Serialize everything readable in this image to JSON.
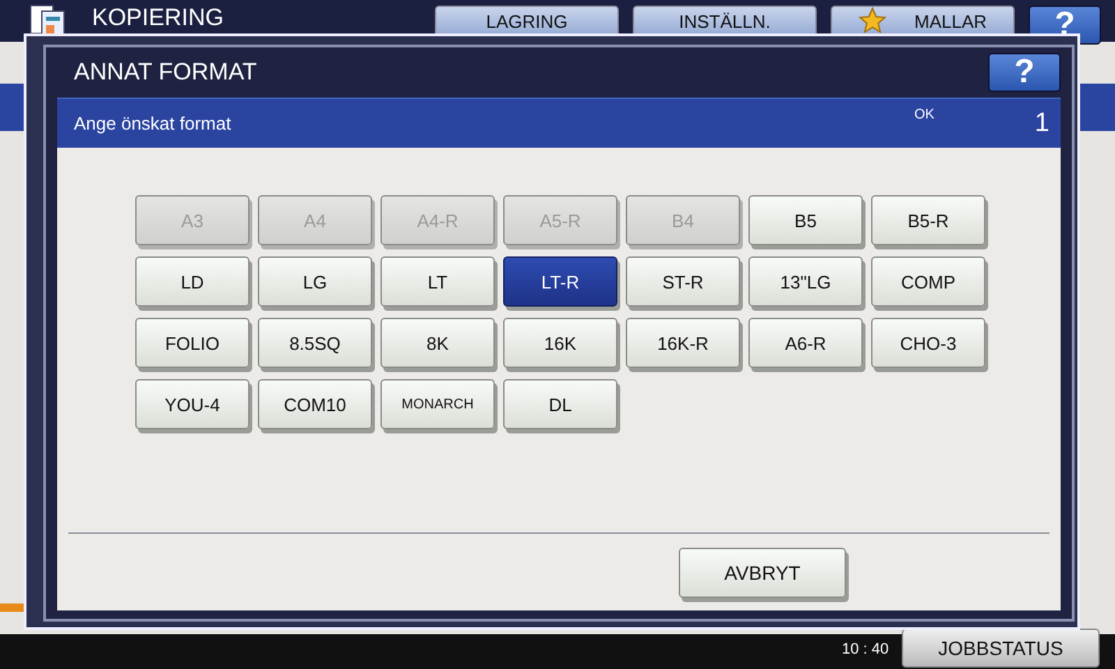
{
  "screen": {
    "title": "KOPIERING",
    "tabs": [
      {
        "label": "LAGRING",
        "icon": false
      },
      {
        "label": "INSTÄLLN.",
        "icon": false
      },
      {
        "label": "MALLAR",
        "icon": true
      }
    ],
    "help": "?",
    "time": "10 : 40",
    "job_status": "JOBBSTATUS"
  },
  "dialog": {
    "title": "ANNAT FORMAT",
    "help": "?",
    "prompt": "Ange önskat format",
    "status": "OK",
    "count": "1",
    "formats": [
      {
        "label": "A3",
        "disabled": true,
        "selected": false
      },
      {
        "label": "A4",
        "disabled": true,
        "selected": false
      },
      {
        "label": "A4-R",
        "disabled": true,
        "selected": false
      },
      {
        "label": "A5-R",
        "disabled": true,
        "selected": false
      },
      {
        "label": "B4",
        "disabled": true,
        "selected": false
      },
      {
        "label": "B5",
        "disabled": false,
        "selected": false
      },
      {
        "label": "B5-R",
        "disabled": false,
        "selected": false
      },
      {
        "label": "LD",
        "disabled": false,
        "selected": false
      },
      {
        "label": "LG",
        "disabled": false,
        "selected": false
      },
      {
        "label": "LT",
        "disabled": false,
        "selected": false
      },
      {
        "label": "LT-R",
        "disabled": false,
        "selected": true
      },
      {
        "label": "ST-R",
        "disabled": false,
        "selected": false
      },
      {
        "label": "13\"LG",
        "disabled": false,
        "selected": false
      },
      {
        "label": "COMP",
        "disabled": false,
        "selected": false
      },
      {
        "label": "FOLIO",
        "disabled": false,
        "selected": false
      },
      {
        "label": "8.5SQ",
        "disabled": false,
        "selected": false
      },
      {
        "label": "8K",
        "disabled": false,
        "selected": false
      },
      {
        "label": "16K",
        "disabled": false,
        "selected": false
      },
      {
        "label": "16K-R",
        "disabled": false,
        "selected": false
      },
      {
        "label": "A6-R",
        "disabled": false,
        "selected": false
      },
      {
        "label": "CHO-3",
        "disabled": false,
        "selected": false
      },
      {
        "label": "YOU-4",
        "disabled": false,
        "selected": false
      },
      {
        "label": "COM10",
        "disabled": false,
        "selected": false
      },
      {
        "label": "MONARCH",
        "disabled": false,
        "selected": false
      },
      {
        "label": "DL",
        "disabled": false,
        "selected": false
      }
    ],
    "cancel": "AVBRYT"
  }
}
